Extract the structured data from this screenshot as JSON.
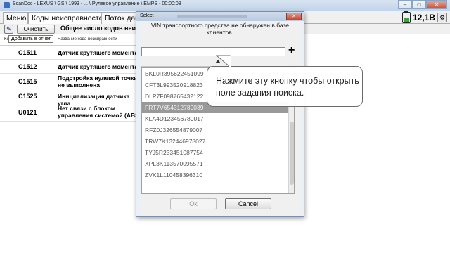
{
  "window": {
    "title": "ScanDoc - LEXUS \\ GS \\ 1993 - ... \\ Рулевое управление \\ EMPS - 00:00:08",
    "buttons": [
      "–",
      "□",
      "✕"
    ]
  },
  "tabs": [
    {
      "label": "Меню",
      "active": false
    },
    {
      "label": "Коды неисправностей",
      "active": true
    },
    {
      "label": "Поток данных",
      "active": false
    }
  ],
  "status": {
    "voltage": "12,1В",
    "battery_level": 0.4
  },
  "toolbar": {
    "clear_label": "Очистить",
    "total_label": "Общее число кодов неисправностей",
    "tooltip": "Добавить в отчет"
  },
  "table": {
    "headers": [
      "Ко",
      "Название кода неисправности"
    ],
    "rows": [
      {
        "code": "C1511",
        "desc": "Датчик крутящего момента"
      },
      {
        "code": "C1512",
        "desc": "Датчик крутящего момента"
      },
      {
        "code": "C1515",
        "desc": "Подстройка нулевой точки не выполнена"
      },
      {
        "code": "C1525",
        "desc": "Инициализация датчика угла"
      },
      {
        "code": "U0121",
        "desc": "Нет связи с блоком управления системой (ABS)"
      }
    ]
  },
  "dialog": {
    "title": "Select",
    "close": "✕",
    "message": "VIN транспортного средства не обнаружен в базе клиентов.",
    "search_value": "",
    "add_icon": "+",
    "vins": [
      {
        "vin": "BKL0R395622451099",
        "selected": false
      },
      {
        "vin": "CFT3L993520918823",
        "selected": false
      },
      {
        "vin": "DLP7F098765432122",
        "selected": false
      },
      {
        "vin": "FRT7V654312789039",
        "selected": true
      },
      {
        "vin": "KLA4D123456789017",
        "selected": false
      },
      {
        "vin": "RFZ0J326554879007",
        "selected": false
      },
      {
        "vin": "TRW7K132446978027",
        "selected": false
      },
      {
        "vin": "TYJ5R233451087754",
        "selected": false
      },
      {
        "vin": "XPL3K113570095571",
        "selected": false
      },
      {
        "vin": "ZVK1L110458396310",
        "selected": false
      }
    ],
    "ok_label": "Ok",
    "cancel_label": "Cancel"
  },
  "callout": {
    "text": "Нажмите эту кнопку чтобы открыть поле задания поиска."
  }
}
